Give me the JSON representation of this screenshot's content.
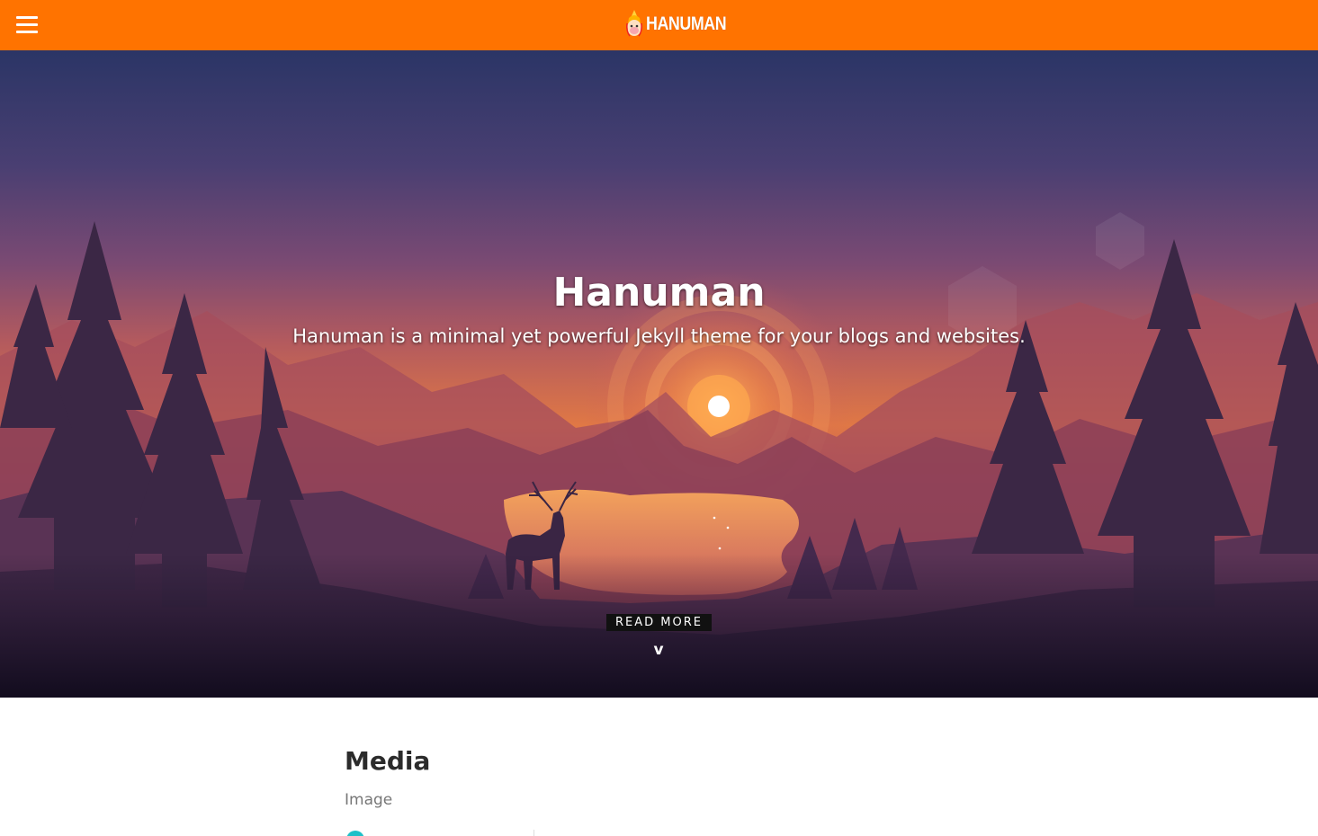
{
  "topbar": {
    "menu_icon": "hamburger-menu-icon",
    "brand_text": "HANUMAN",
    "brand_logo_icon": "hanuman-logo-icon",
    "background_color": "#ff7300"
  },
  "hero": {
    "title": "Hanuman",
    "subtitle": "Hanuman is a minimal yet powerful Jekyll theme for your blogs and websites.",
    "read_more_label": "READ MORE",
    "scroll_down_label": "v"
  },
  "content": {
    "heading": "Media",
    "subheading": "Image"
  }
}
